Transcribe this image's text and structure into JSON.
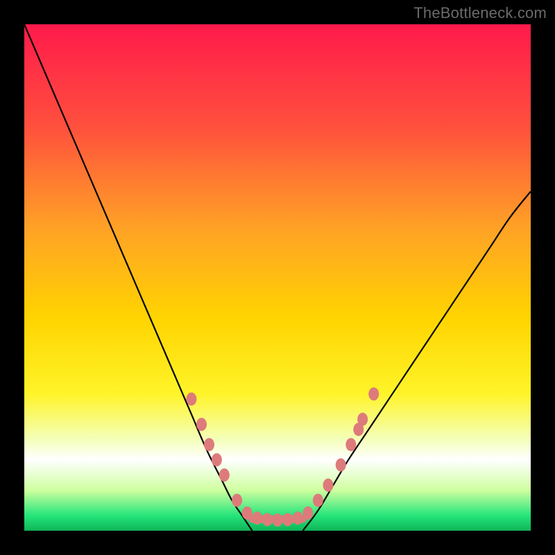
{
  "watermark": "TheBottleneck.com",
  "chart_data": {
    "type": "line",
    "title": "",
    "xlabel": "",
    "ylabel": "",
    "xlim": [
      0,
      100
    ],
    "ylim": [
      0,
      100
    ],
    "grid": false,
    "legend": false,
    "background_gradient": [
      {
        "pos": 0.0,
        "color": "#ff1a4b"
      },
      {
        "pos": 0.2,
        "color": "#ff4f3d"
      },
      {
        "pos": 0.4,
        "color": "#ffa126"
      },
      {
        "pos": 0.58,
        "color": "#ffd400"
      },
      {
        "pos": 0.73,
        "color": "#fff429"
      },
      {
        "pos": 0.82,
        "color": "#f4ffba"
      },
      {
        "pos": 0.86,
        "color": "#ffffff"
      },
      {
        "pos": 0.92,
        "color": "#cfff9f"
      },
      {
        "pos": 0.97,
        "color": "#25e57a"
      },
      {
        "pos": 1.0,
        "color": "#0fb558"
      }
    ],
    "series": [
      {
        "name": "left-curve",
        "x": [
          0,
          3,
          6,
          9,
          12,
          15,
          18,
          21,
          24,
          27,
          30,
          33,
          36,
          39,
          41,
          43,
          45
        ],
        "y": [
          100,
          93,
          86,
          79,
          72,
          65,
          58,
          51,
          44,
          37,
          30,
          23,
          16,
          10,
          6,
          3,
          0
        ]
      },
      {
        "name": "right-curve",
        "x": [
          55,
          58,
          61,
          64,
          68,
          72,
          76,
          80,
          84,
          88,
          92,
          96,
          100
        ],
        "y": [
          0,
          4,
          9,
          14,
          20,
          26,
          32,
          38,
          44,
          50,
          56,
          62,
          67
        ]
      },
      {
        "name": "valley-floor",
        "x": [
          45,
          47,
          49,
          51,
          53,
          55
        ],
        "y": [
          0,
          0,
          0,
          0,
          0,
          0
        ]
      }
    ],
    "markers": {
      "name": "dots",
      "color": "#dd7b7b",
      "points": [
        {
          "x": 33,
          "y": 26
        },
        {
          "x": 35,
          "y": 21
        },
        {
          "x": 36.5,
          "y": 17
        },
        {
          "x": 38,
          "y": 14
        },
        {
          "x": 39.5,
          "y": 11
        },
        {
          "x": 42,
          "y": 6
        },
        {
          "x": 44,
          "y": 3.5
        },
        {
          "x": 46,
          "y": 2.5
        },
        {
          "x": 48,
          "y": 2.2
        },
        {
          "x": 50,
          "y": 2.1
        },
        {
          "x": 52,
          "y": 2.2
        },
        {
          "x": 54,
          "y": 2.5
        },
        {
          "x": 56,
          "y": 3.5
        },
        {
          "x": 58,
          "y": 6
        },
        {
          "x": 60,
          "y": 9
        },
        {
          "x": 62.5,
          "y": 13
        },
        {
          "x": 64.5,
          "y": 17
        },
        {
          "x": 66,
          "y": 20
        },
        {
          "x": 66.8,
          "y": 22
        },
        {
          "x": 69,
          "y": 27
        }
      ]
    }
  }
}
